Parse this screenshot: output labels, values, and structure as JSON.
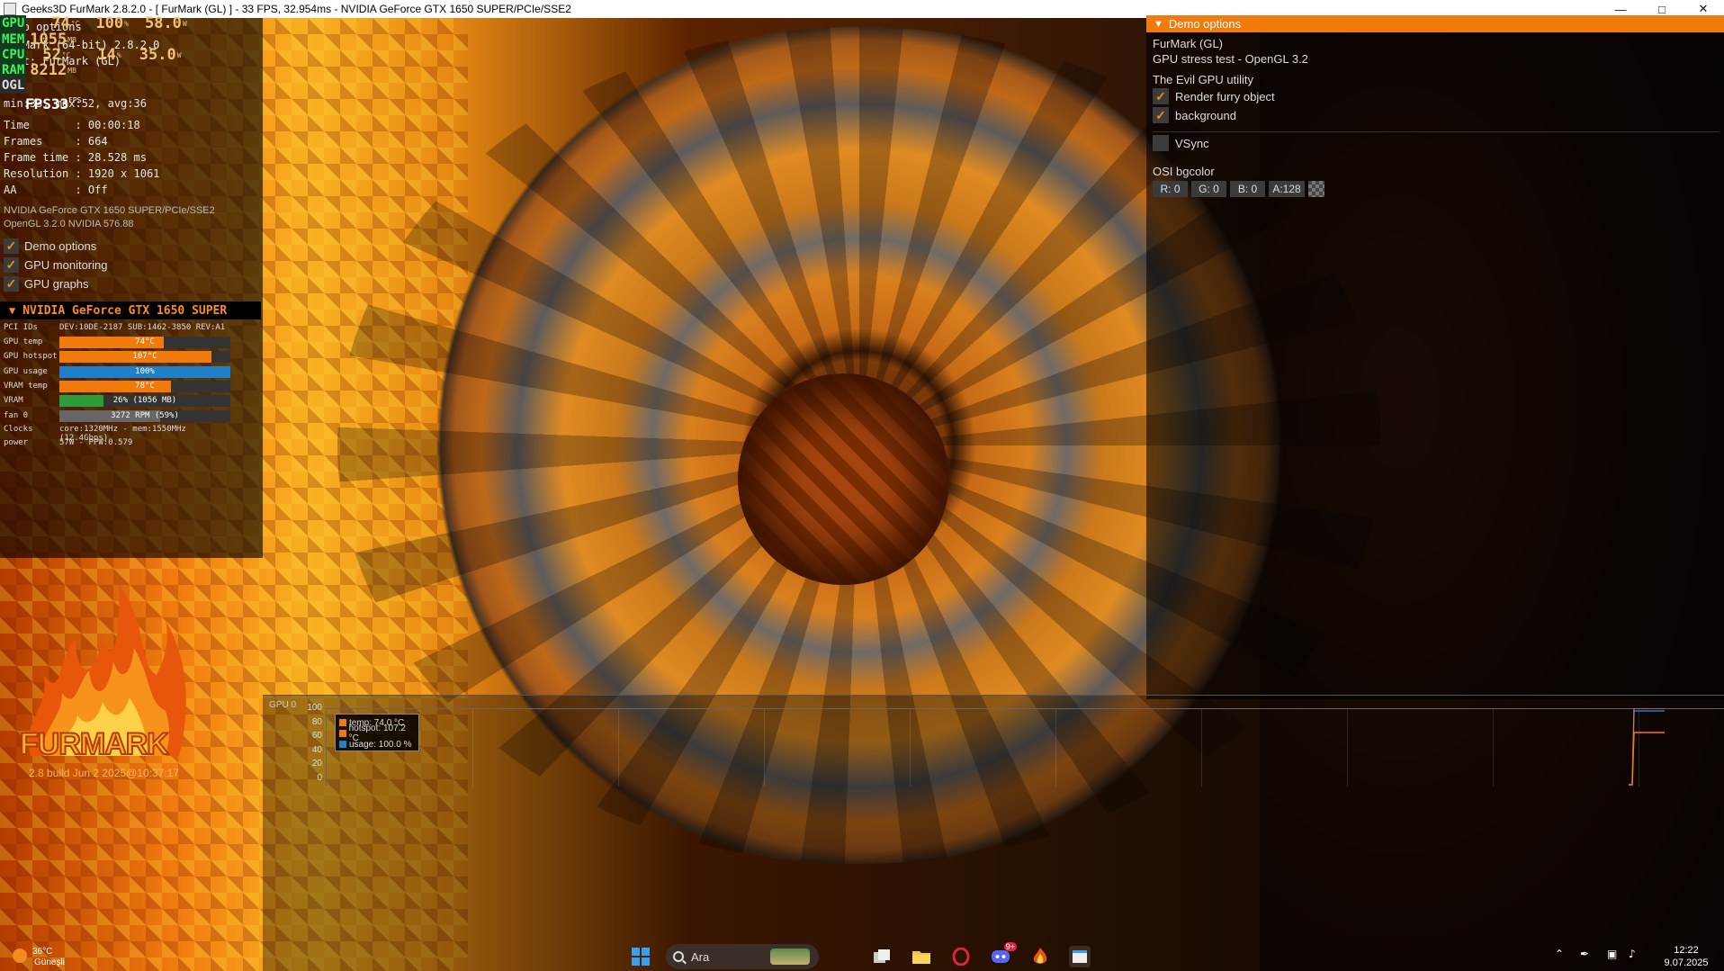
{
  "window": {
    "title": "Geeks3D FurMark 2.8.2.0 - [ FurMark (GL) ] - 33 FPS, 32.954ms - NVIDIA GeForce GTX 1650 SUPER/PCIe/SSE2",
    "minimize_icon": "minimize-icon",
    "maximize_icon": "maximize-icon",
    "close_icon": "close-icon"
  },
  "osd_overlay": {
    "gpu_badge": "GPU",
    "gpu_temp": "74",
    "gpu_temp_unit": "°C",
    "gpu_usage": "100",
    "gpu_usage_unit": "%",
    "gpu_power": "58.0",
    "gpu_power_unit": "W",
    "mem_badge": "MEM",
    "mem_value": "1055",
    "mem_unit": "MB",
    "cpu_badge": "CPU",
    "cpu_temp": "52",
    "cpu_temp_unit": "°C",
    "cpu_usage": "14",
    "cpu_usage_unit": "%",
    "cpu_power": "35.0",
    "cpu_power_unit": "W",
    "ram_badge": "RAM",
    "ram_value": "8212",
    "ram_unit": "MB",
    "ogl_badge": "OGL",
    "fps_label": "FPS",
    "fps_value": "33",
    "fps_unit": "FPS",
    "ghost_line1": "Demo options",
    "ghost_line2": "FurMark (64-bit) 2.8.2.0",
    "ghost_line3": "Test: FurMark (GL)"
  },
  "stats": {
    "minmax": "min:33, max:52, avg:36",
    "time": "Time       : 00:00:18",
    "frames": "Frames     : 664",
    "frame_time": "Frame time : 28.528 ms",
    "resolution": "Resolution : 1920 x 1061",
    "aa": "AA         : Off",
    "gpu_name": "NVIDIA GeForce GTX 1650 SUPER/PCIe/SSE2",
    "gl_version": "OpenGL 3.2.0 NVIDIA 576.88"
  },
  "toggles": [
    {
      "label": "Demo options",
      "checked": true
    },
    {
      "label": "GPU monitoring",
      "checked": true
    },
    {
      "label": "GPU graphs",
      "checked": true
    }
  ],
  "gpu_monitor": {
    "header": "NVIDIA GeForce GTX 1650 SUPER",
    "pci_label": "PCI IDs",
    "pci_value": "DEV:10DE-2187 SUB:1462-3850 REV:A1",
    "rows": [
      {
        "label": "GPU temp",
        "value": "74°C",
        "fraction": 0.61,
        "color": "#f07a0c"
      },
      {
        "label": "GPU hotspot",
        "value": "107°C",
        "fraction": 0.89,
        "color": "#f07a0c"
      },
      {
        "label": "GPU usage",
        "value": "100%",
        "fraction": 1.0,
        "color": "#1f7fc8"
      },
      {
        "label": "VRAM temp",
        "value": "78°C",
        "fraction": 0.65,
        "color": "#f07a0c"
      },
      {
        "label": "VRAM",
        "value": "26% (1056 MB)",
        "fraction": 0.26,
        "color": "#2f9a3a"
      },
      {
        "label": "fan 0",
        "value": "3272 RPM (59%)",
        "fraction": 0.59,
        "color": "#666666"
      }
    ],
    "clocks_label": "Clocks",
    "clocks_value": "core:1320MHz - mem:1550MHz (12.4Gbps)",
    "power_label": "power",
    "power_value": "57W - PPW:0.579"
  },
  "logo": {
    "text": "FURMARK",
    "build": "2.8 build Jun  2 2025@10:37:17"
  },
  "demo_options": {
    "header": "Demo options",
    "renderer": "FurMark (GL)",
    "description": "GPU stress test - OpenGL 3.2",
    "section": "The Evil GPU utility",
    "render_furry": {
      "label": "Render furry object",
      "checked": true
    },
    "background": {
      "label": "background",
      "checked": true
    },
    "vsync": {
      "label": "VSync",
      "checked": false
    },
    "osi_label": "OSI bgcolor",
    "r": "R: 0",
    "g": "G: 0",
    "b": "B: 0",
    "a": "A:128"
  },
  "graph": {
    "label": "GPU 0",
    "y_ticks": [
      "100",
      "80",
      "60",
      "40",
      "20",
      "0"
    ],
    "legend": [
      {
        "text": "temp: 74.0 °C",
        "color": "#f07a0c"
      },
      {
        "text": "hotspot: 107.2 °C",
        "color": "#f07a0c"
      },
      {
        "text": "usage: 100.0 %",
        "color": "#1f7fc8"
      }
    ]
  },
  "taskbar": {
    "weather_temp": "36°C",
    "weather_cond": "Güneşli",
    "search_placeholder": "Ara",
    "time": "12:22",
    "date": "9.07.2025",
    "apps": [
      "windows-start-icon",
      "search-icon",
      "landscape-widget-icon",
      "task-view-icon",
      "file-explorer-icon",
      "opera-icon",
      "discord-icon",
      "furmark-icon",
      "app-window-icon"
    ],
    "discord_badge": "9+"
  }
}
